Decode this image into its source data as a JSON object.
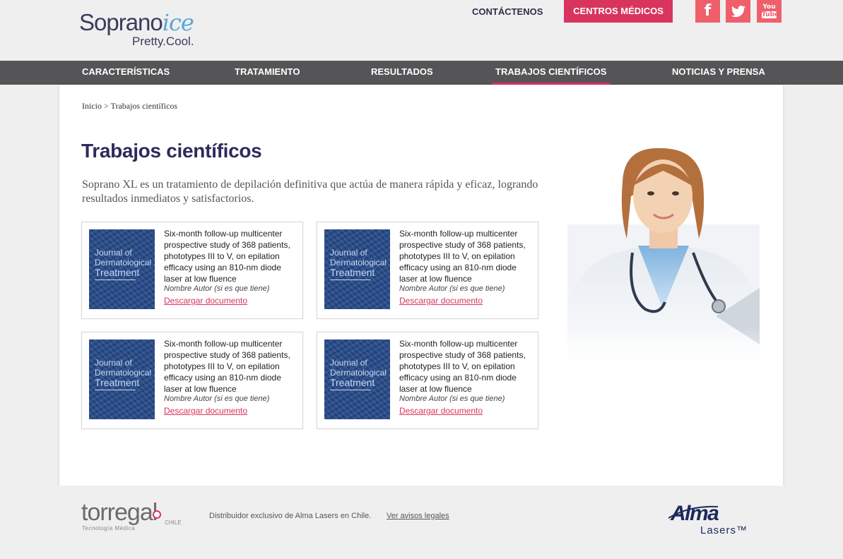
{
  "header": {
    "logo_main": "Soprano",
    "logo_accent": "ice",
    "logo_tagline": "Pretty.Cool.",
    "contact": "CONTÁCTENOS",
    "centers": "CENTROS MÉDICOS",
    "social": [
      {
        "icon": "facebook-icon",
        "glyph": "f"
      },
      {
        "icon": "twitter-icon",
        "glyph": "t"
      },
      {
        "icon": "youtube-icon",
        "line1": "You",
        "line2": "Tube"
      }
    ]
  },
  "nav": {
    "items": [
      {
        "label": "CARACTERÍSTICAS"
      },
      {
        "label": "TRATAMIENTO"
      },
      {
        "label": "RESULTADOS"
      },
      {
        "label": "TRABAJOS CIENTÍFICOS",
        "active": true
      },
      {
        "label": "NOTICIAS Y PRENSA"
      }
    ]
  },
  "breadcrumb": "Inicio > Trabajos científicos",
  "page_title": "Trabajos científicos",
  "intro": "Soprano XL es un tratamiento de depilación definitiva que actúa de manera rápida y eficaz, logrando resultados  inmediatos y satisfactorios.",
  "journal_cover": {
    "line1": "Journal of",
    "line2": "Dermatological",
    "line3": "Treatment"
  },
  "papers": [
    {
      "title": "Six-month follow-up multicenter prospective study of 368 patients, phototypes III to V, on epilation efficacy using an 810-nm diode laser at low fluence",
      "author": "Nombre Autor (si es que tiene)",
      "link": "Descargar documento"
    },
    {
      "title": "Six-month follow-up multicenter prospective study of 368 patients, phototypes III to V, on epilation efficacy using an 810-nm diode laser at low fluence",
      "author": "Nombre Autor (si es que tiene)",
      "link": "Descargar documento"
    },
    {
      "title": "Six-month follow-up multicenter prospective study of 368 patients, phototypes III to V, on epilation efficacy using an 810-nm diode laser at low fluence",
      "author": "Nombre Autor (si es que tiene)",
      "link": "Descargar documento"
    },
    {
      "title": "Six-month follow-up multicenter prospective study of 368 patients, phototypes III to V, on epilation efficacy using an 810-nm diode laser at low fluence",
      "author": "Nombre Autor (si es que tiene)",
      "link": "Descargar documento"
    }
  ],
  "footer": {
    "brand_name": "torregal",
    "brand_sub": "Tecnología Médica",
    "brand_country": "CHILE",
    "text": "Distribuidor exclusivo de Alma Lasers en Chile.",
    "link": "Ver avisos legales",
    "partner_name": "Alma",
    "partner_sub": "Lasers™"
  },
  "colors": {
    "accent": "#d9345e",
    "nav_bg": "#555557",
    "title": "#2d2b5c"
  }
}
